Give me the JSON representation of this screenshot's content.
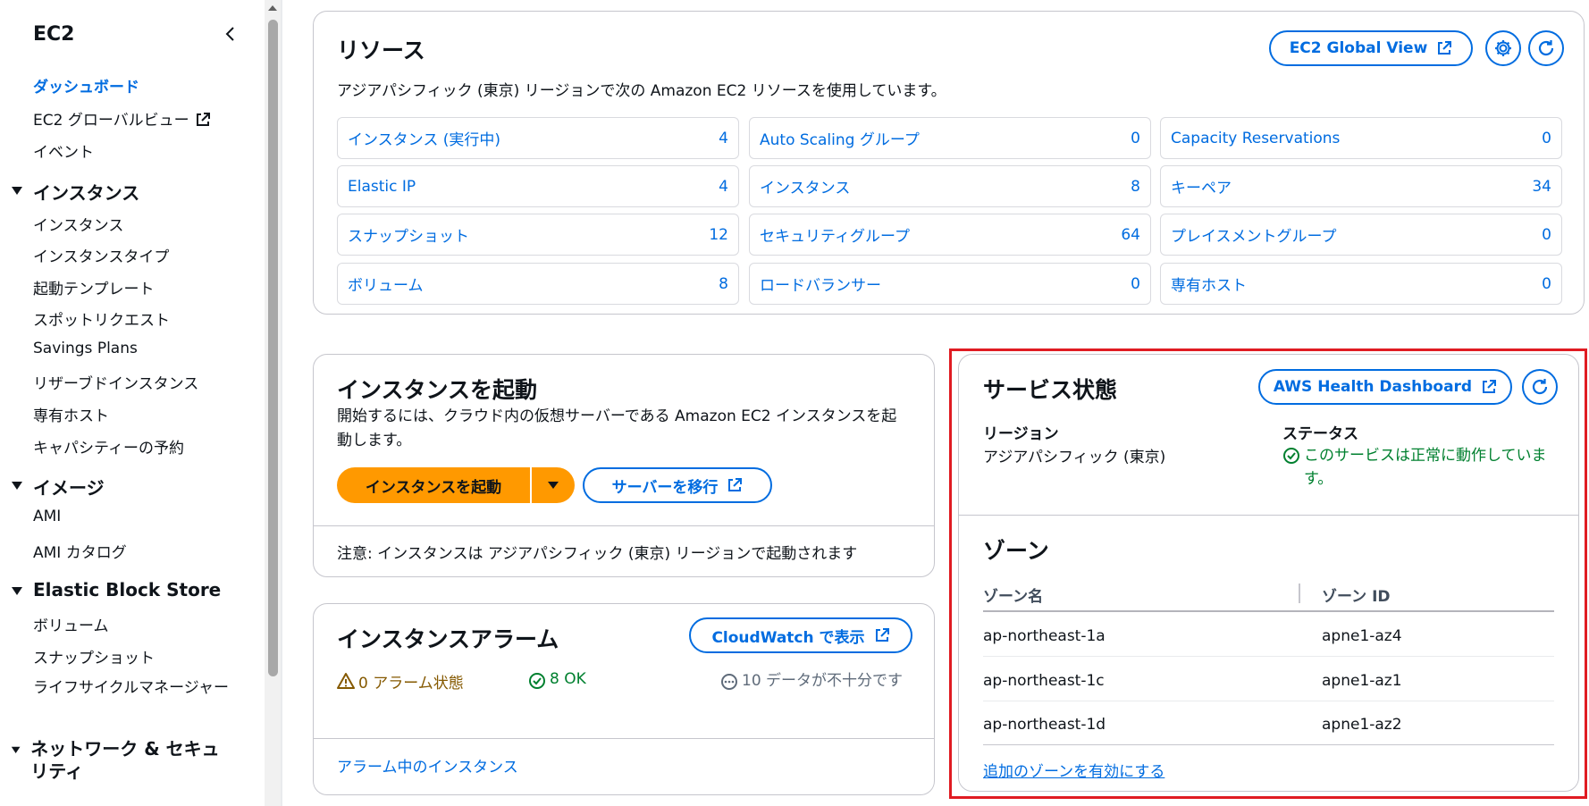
{
  "sidebar": {
    "title": "EC2",
    "links_top": [
      "ダッシュボード",
      "EC2 グローバルビュー",
      "イベント"
    ],
    "sections": [
      {
        "label": "インスタンス",
        "items": [
          "インスタンス",
          "インスタンスタイプ",
          "起動テンプレート",
          "スポットリクエスト",
          "Savings Plans",
          "リザーブドインスタンス",
          "専有ホスト",
          "キャパシティーの予約"
        ]
      },
      {
        "label": "イメージ",
        "items": [
          "AMI",
          "AMI カタログ"
        ]
      },
      {
        "label": "Elastic Block Store",
        "items": [
          "ボリューム",
          "スナップショット",
          "ライフサイクルマネージャー"
        ]
      },
      {
        "label": "ネットワーク & セキュリティ",
        "items": []
      }
    ]
  },
  "resources": {
    "title": "リソース",
    "global_view_label": "EC2 Global View",
    "description": "アジアパシフィック (東京) リージョンで次の Amazon EC2 リソースを使用しています。",
    "cells": [
      {
        "label": "インスタンス (実行中)",
        "count": "4"
      },
      {
        "label": "Auto Scaling グループ",
        "count": "0"
      },
      {
        "label": "Capacity Reservations",
        "count": "0"
      },
      {
        "label": "Elastic IP",
        "count": "4"
      },
      {
        "label": "インスタンス",
        "count": "8"
      },
      {
        "label": "キーペア",
        "count": "34"
      },
      {
        "label": "スナップショット",
        "count": "12"
      },
      {
        "label": "セキュリティグループ",
        "count": "64"
      },
      {
        "label": "プレイスメントグループ",
        "count": "0"
      },
      {
        "label": "ボリューム",
        "count": "8"
      },
      {
        "label": "ロードバランサー",
        "count": "0"
      },
      {
        "label": "専有ホスト",
        "count": "0"
      }
    ]
  },
  "launch": {
    "title": "インスタンスを起動",
    "description": "開始するには、クラウド内の仮想サーバーである Amazon EC2 インスタンスを起動します。",
    "launch_label": "インスタンスを起動",
    "migrate_label": "サーバーを移行",
    "note": "注意: インスタンスは アジアパシフィック (東京) リージョンで起動されます"
  },
  "alarms": {
    "title": "インスタンスアラーム",
    "cloudwatch_label": "CloudWatch で表示",
    "alarm_state": "0 アラーム状態",
    "ok": "8 OK",
    "insufficient": "10 データが不十分です",
    "link": "アラーム中のインスタンス"
  },
  "health": {
    "title": "サービス状態",
    "dashboard_label": "AWS Health Dashboard",
    "region_label": "リージョン",
    "region_value": "アジアパシフィック (東京)",
    "status_label": "ステータス",
    "status_value": "このサービスは正常に動作しています。",
    "zones_title": "ゾーン",
    "col_name": "ゾーン名",
    "col_id": "ゾーン ID",
    "zones": [
      {
        "name": "ap-northeast-1a",
        "id": "apne1-az4"
      },
      {
        "name": "ap-northeast-1c",
        "id": "apne1-az1"
      },
      {
        "name": "ap-northeast-1d",
        "id": "apne1-az2"
      }
    ],
    "enable_zones": "追加のゾーンを有効にする"
  },
  "colors": {
    "link": "#006ce0",
    "primary": "#ff9900",
    "success": "#00802f",
    "warning": "#855900",
    "highlight": "#e01b22"
  }
}
